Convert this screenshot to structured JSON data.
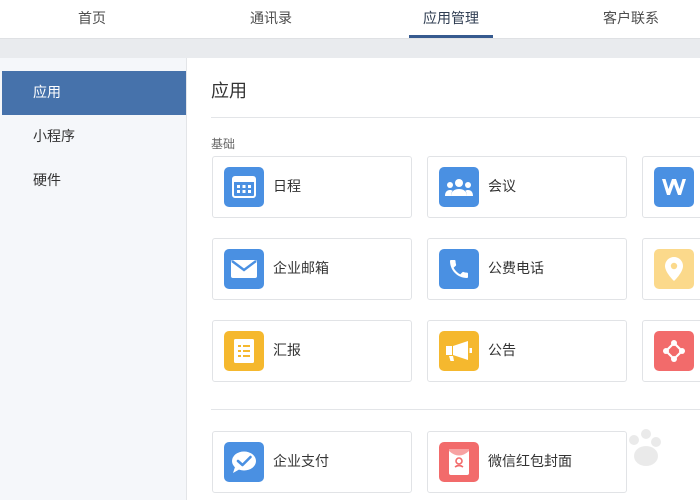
{
  "topnav": {
    "tabs": [
      {
        "label": "首页"
      },
      {
        "label": "通讯录"
      },
      {
        "label": "应用管理",
        "active": true
      },
      {
        "label": "客户联系"
      }
    ]
  },
  "sidebar": {
    "items": [
      {
        "label": "应用",
        "active": true
      },
      {
        "label": "小程序"
      },
      {
        "label": "硬件"
      }
    ]
  },
  "main": {
    "title": "应用",
    "section_label": "基础",
    "apps": [
      {
        "label": "日程",
        "icon": "calendar-icon",
        "color": "#4a90e2"
      },
      {
        "label": "会议",
        "icon": "people-icon",
        "color": "#4a90e2"
      },
      {
        "label": "",
        "icon": "w-doc-icon",
        "color": "#4a90e2"
      },
      {
        "label": "企业邮箱",
        "icon": "mail-icon",
        "color": "#4a90e2"
      },
      {
        "label": "公费电话",
        "icon": "phone-icon",
        "color": "#4a90e2"
      },
      {
        "label": "",
        "icon": "location-icon",
        "color": "#fbd98b"
      },
      {
        "label": "汇报",
        "icon": "report-icon",
        "color": "#f5b82e"
      },
      {
        "label": "公告",
        "icon": "megaphone-icon",
        "color": "#f5b82e"
      },
      {
        "label": "",
        "icon": "share-nodes-icon",
        "color": "#f26b6b"
      },
      {
        "label": "企业支付",
        "icon": "chat-check-icon",
        "color": "#4a90e2"
      },
      {
        "label": "微信红包封面",
        "icon": "red-envelope-icon",
        "color": "#f26b6b"
      }
    ]
  },
  "colors": {
    "accent": "#4672ab",
    "tab_underline": "#365a8f",
    "blue_icon": "#4a90e2",
    "yellow_icon": "#f5b82e",
    "red_icon": "#f26b6b"
  }
}
